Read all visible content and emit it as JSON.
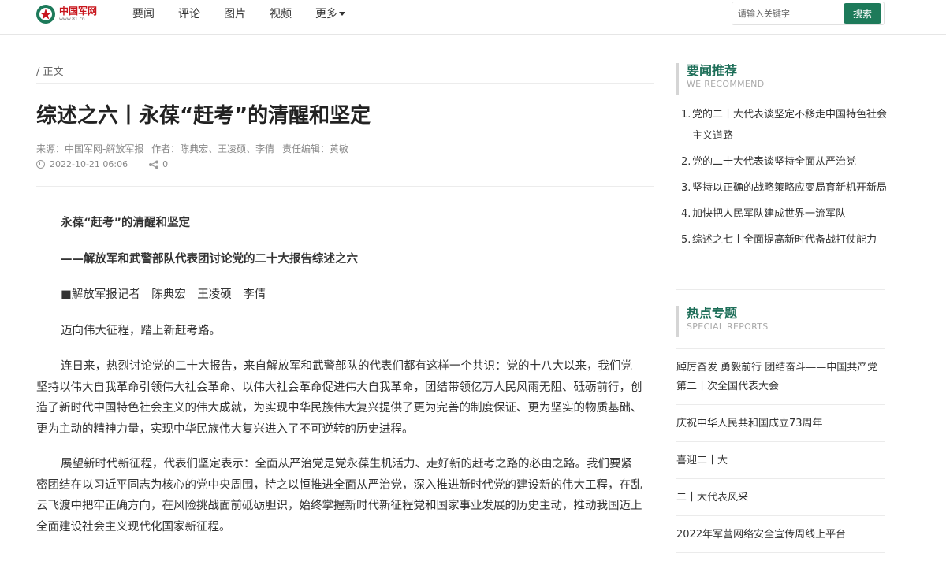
{
  "header": {
    "logo_text": "中国军网",
    "logo_sub": "www.81.cn",
    "nav": [
      "要闻",
      "评论",
      "图片",
      "视频",
      "更多"
    ],
    "search_placeholder": "请输入关键字",
    "search_button": "搜索"
  },
  "article": {
    "breadcrumb": "/ 正文",
    "title": "综述之六丨永葆“赶考”的清醒和坚定",
    "source": "来源：中国军网-解放军报",
    "author": "作者：陈典宏、王凌硕、李倩",
    "editor": "责任编辑：黄敏",
    "date": "2022-10-21 06:06",
    "share_count": "0",
    "paragraphs": [
      "永葆“赶考”的清醒和坚定",
      "——解放军和武警部队代表团讨论党的二十大报告综述之六",
      "■解放军报记者　陈典宏　王凌硕　李倩",
      "迈向伟大征程，踏上新赶考路。",
      "连日来，热烈讨论党的二十大报告，来自解放军和武警部队的代表们都有这样一个共识：党的十八大以来，我们党坚持以伟大自我革命引领伟大社会革命、以伟大社会革命促进伟大自我革命，团结带领亿万人民风雨无阻、砥砺前行，创造了新时代中国特色社会主义的伟大成就，为实现中华民族伟大复兴提供了更为完善的制度保证、更为坚实的物质基础、更为主动的精神力量，实现中华民族伟大复兴进入了不可逆转的历史进程。",
      "展望新时代新征程，代表们坚定表示：全面从严治党是党永葆生机活力、走好新的赶考之路的必由之路。我们要紧密团结在以习近平同志为核心的党中央周围，持之以恒推进全面从严治党，深入推进新时代党的建设新的伟大工程，在乱云飞渡中把牢正确方向，在风险挑战面前砥砺胆识，始终掌握新时代新征程党和国家事业发展的历史主动，推动我国迈上全面建设社会主义现代化国家新征程。"
    ]
  },
  "sidebar": {
    "recommend_title": "要闻推荐",
    "recommend_sub": "WE RECOMMEND",
    "recommend_items": [
      {
        "num": "1.",
        "text": "党的二十大代表谈坚定不移走中国特色社会主义道路"
      },
      {
        "num": "2.",
        "text": "党的二十大代表谈坚持全面从严治党"
      },
      {
        "num": "3.",
        "text": "坚持以正确的战略策略应变局育新机开新局"
      },
      {
        "num": "4.",
        "text": "加快把人民军队建成世界一流军队"
      },
      {
        "num": "5.",
        "text": "综述之七丨全面提高新时代备战打仗能力"
      }
    ],
    "special_title": "热点专题",
    "special_sub": "SPECIAL REPORTS",
    "special_items": [
      "踔厉奋发 勇毅前行 团结奋斗——中国共产党第二十次全国代表大会",
      "庆祝中华人民共和国成立73周年",
      "喜迎二十大",
      "二十大代表风采",
      "2022年军营网络安全宣传周线上平台"
    ]
  },
  "colors": {
    "brand_green": "#1d7a5a",
    "logo_red": "#c8161d",
    "side_title": "#1d6e58"
  }
}
